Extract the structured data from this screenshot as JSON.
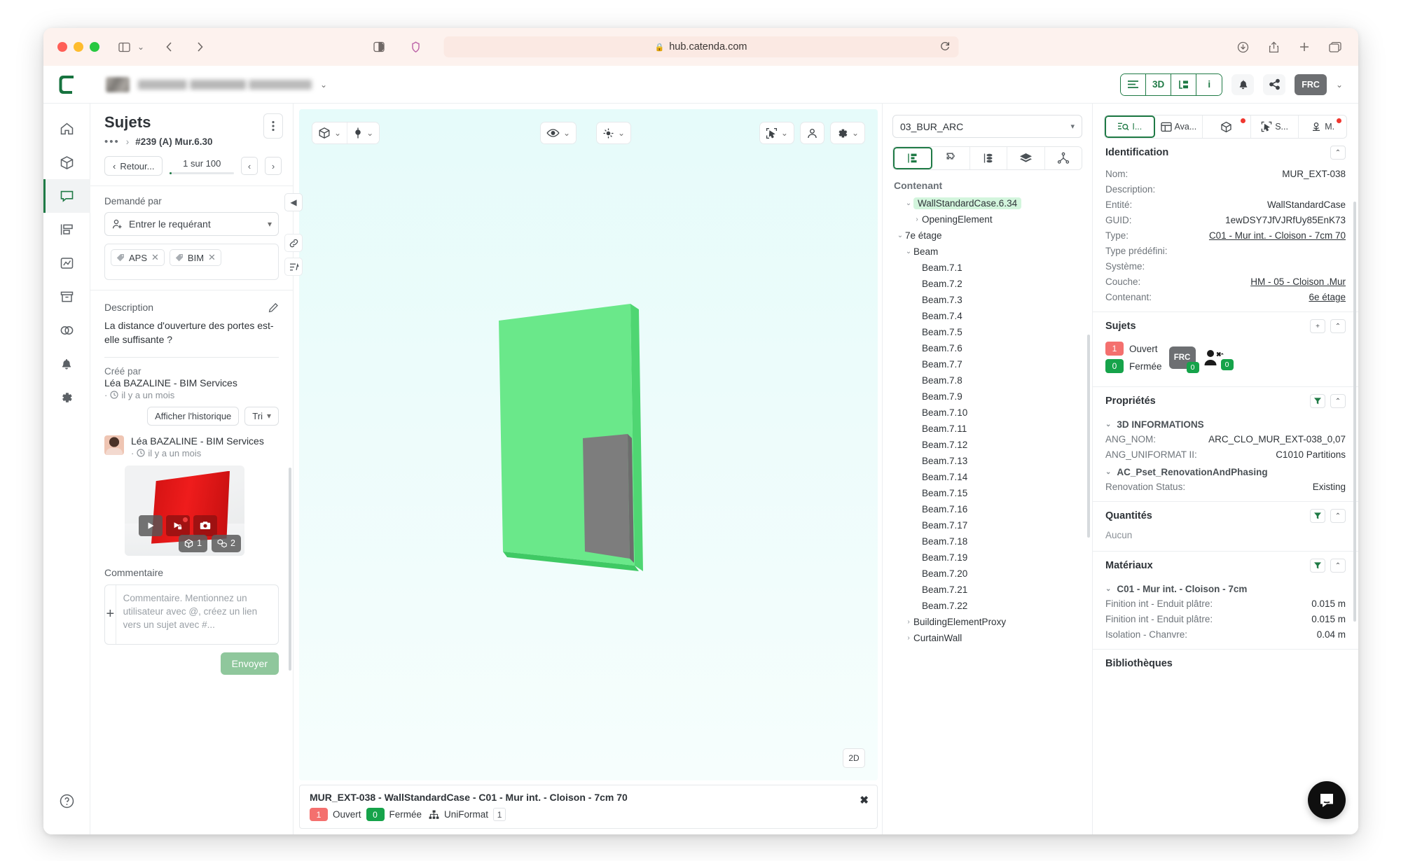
{
  "browser": {
    "url": "hub.catenda.com",
    "lock_icon": "lock-icon",
    "reload_icon": "reload-icon"
  },
  "app_header": {
    "logo": "catenda-logo",
    "view_toggle": [
      {
        "label": "≡",
        "name": "list-view"
      },
      {
        "label": "3D",
        "name": "3d-view"
      },
      {
        "label": "⇥",
        "name": "tree-view"
      },
      {
        "label": "i",
        "name": "info-view"
      }
    ],
    "notifications_icon": "bell-icon",
    "share_icon": "share-icon",
    "avatar_initials": "FRC"
  },
  "rail": {
    "items": [
      {
        "name": "home",
        "icon": "home-icon"
      },
      {
        "name": "models",
        "icon": "cube-icon"
      },
      {
        "name": "issues",
        "icon": "chat-icon",
        "active": true
      },
      {
        "name": "documents",
        "icon": "kanban-icon"
      },
      {
        "name": "reports",
        "icon": "chart-icon"
      },
      {
        "name": "archive",
        "icon": "archive-icon"
      },
      {
        "name": "compare",
        "icon": "layers-icon"
      },
      {
        "name": "notifications",
        "icon": "bell-icon"
      },
      {
        "name": "settings",
        "icon": "gear-icon"
      }
    ],
    "help_icon": "question-icon"
  },
  "sujets": {
    "title": "Sujets",
    "breadcrumb_dots": "•••",
    "breadcrumb_sep": "›",
    "breadcrumb_current": "#239 (A) Mur.6.30",
    "kebab_icon": "kebab-menu-icon",
    "back_label": "Retour...",
    "counter": "1 sur 100",
    "prev_icon": "‹",
    "next_icon": "›",
    "requested_by_label": "Demandé par",
    "requester_placeholder": "Entrer le requérant",
    "tags": [
      {
        "label": "APS"
      },
      {
        "label": "BIM"
      }
    ],
    "description_label": "Description",
    "description_edit_icon": "pencil-icon",
    "description_text": "La distance d'ouverture des portes est-elle suffisante ?",
    "created_by_label": "Créé par",
    "created_by_name": "Léa BAZALINE - BIM Services",
    "created_time": "il y a un mois",
    "history_button": "Afficher l'historique",
    "sort_button": "Tri",
    "comment_author": "Léa BAZALINE - BIM Services",
    "comment_time": "il y a un mois",
    "thumb_badges": [
      {
        "icon": "cube-icon",
        "value": "1"
      },
      {
        "icon": "cubes-icon",
        "value": "2"
      }
    ],
    "thumb_controls": [
      {
        "name": "play-icon"
      },
      {
        "name": "play-lock-icon"
      },
      {
        "name": "camera-icon"
      }
    ],
    "comment_label": "Commentaire",
    "comment_placeholder": "Commentaire. Mentionnez un utilisateur avec @, créez un lien vers un sujet avec #...",
    "add_icon": "plus-icon",
    "send_label": "Envoyer"
  },
  "viewer": {
    "toolbar_left": [
      {
        "name": "cube-icon",
        "caret": "⌄"
      },
      {
        "name": "pin-icon",
        "caret": "⌄"
      }
    ],
    "toolbar_mid": [
      {
        "name": "eye-icon",
        "caret": "⌄"
      },
      {
        "name": "explode-icon",
        "caret": "⌄"
      }
    ],
    "toolbar_right": [
      {
        "name": "select-icon",
        "caret": "⌄"
      },
      {
        "name": "person-icon",
        "caret": ""
      },
      {
        "name": "gear-icon",
        "caret": "⌄"
      }
    ],
    "btn_2d": "2D",
    "status": {
      "title": "MUR_EXT-038 - WallStandardCase - C01 - Mur int. - Cloison - 7cm 70",
      "open_count": "1",
      "open_label": "Ouvert",
      "closed_count": "0",
      "closed_label": "Fermée",
      "uniformat_icon": "hierarchy-icon",
      "uniformat_label": "UniFormat",
      "uniformat_count": "1",
      "close_icon": "✖"
    }
  },
  "tree": {
    "model": "03_BUR_ARC",
    "tabs": [
      {
        "name": "structure-icon",
        "active": true
      },
      {
        "name": "puzzle-icon",
        "active": false
      },
      {
        "name": "stack-icon",
        "active": false
      },
      {
        "name": "layers-icon",
        "active": false
      },
      {
        "name": "topology-icon",
        "active": false
      }
    ],
    "heading": "Contenant",
    "nodes": [
      {
        "label": "WallStandardCase.6.34",
        "indent": 2,
        "arrow": "⌄",
        "highlight": true
      },
      {
        "label": "OpeningElement",
        "indent": 3,
        "arrow": "›"
      },
      {
        "label": "7e étage",
        "indent": 1,
        "arrow": "⌄"
      },
      {
        "label": "Beam",
        "indent": 2,
        "arrow": "⌄"
      },
      {
        "label": "Beam.7.1",
        "indent": 3
      },
      {
        "label": "Beam.7.2",
        "indent": 3
      },
      {
        "label": "Beam.7.3",
        "indent": 3
      },
      {
        "label": "Beam.7.4",
        "indent": 3
      },
      {
        "label": "Beam.7.5",
        "indent": 3
      },
      {
        "label": "Beam.7.6",
        "indent": 3
      },
      {
        "label": "Beam.7.7",
        "indent": 3
      },
      {
        "label": "Beam.7.8",
        "indent": 3
      },
      {
        "label": "Beam.7.9",
        "indent": 3
      },
      {
        "label": "Beam.7.10",
        "indent": 3
      },
      {
        "label": "Beam.7.11",
        "indent": 3
      },
      {
        "label": "Beam.7.12",
        "indent": 3
      },
      {
        "label": "Beam.7.13",
        "indent": 3
      },
      {
        "label": "Beam.7.14",
        "indent": 3
      },
      {
        "label": "Beam.7.15",
        "indent": 3
      },
      {
        "label": "Beam.7.16",
        "indent": 3
      },
      {
        "label": "Beam.7.17",
        "indent": 3
      },
      {
        "label": "Beam.7.18",
        "indent": 3
      },
      {
        "label": "Beam.7.19",
        "indent": 3
      },
      {
        "label": "Beam.7.20",
        "indent": 3
      },
      {
        "label": "Beam.7.21",
        "indent": 3
      },
      {
        "label": "Beam.7.22",
        "indent": 3
      },
      {
        "label": "BuildingElementProxy",
        "indent": 2,
        "arrow": "›"
      },
      {
        "label": "CurtainWall",
        "indent": 2,
        "arrow": "›"
      }
    ]
  },
  "properties": {
    "tabs": [
      {
        "label": "I...",
        "icon": "identification-icon",
        "active": true,
        "dot": false
      },
      {
        "label": "Ava...",
        "icon": "table-icon",
        "active": false,
        "dot": false
      },
      {
        "label": "",
        "icon": "cube-icon",
        "active": false,
        "dot": true
      },
      {
        "label": "S...",
        "icon": "select-icon",
        "active": false,
        "dot": false
      },
      {
        "label": "M.",
        "icon": "anchor-icon",
        "active": false,
        "dot": true
      }
    ],
    "identification": {
      "title": "Identification",
      "rows": [
        {
          "key": "Nom:",
          "value": "MUR_EXT-038",
          "link": false
        },
        {
          "key": "Description:",
          "value": "",
          "link": false
        },
        {
          "key": "Entité:",
          "value": "WallStandardCase",
          "link": false
        },
        {
          "key": "GUID:",
          "value": "1ewDSY7JfVJRfUy85EnK73",
          "link": false
        },
        {
          "key": "Type:",
          "value": "C01 - Mur int. - Cloison - 7cm 70",
          "link": true
        },
        {
          "key": "Type prédéfini:",
          "value": "",
          "link": false
        },
        {
          "key": "Système:",
          "value": "",
          "link": false
        },
        {
          "key": "Couche:",
          "value": "HM - 05 - Cloison .Mur",
          "link": true
        },
        {
          "key": "Contenant:",
          "value": "6e étage",
          "link": true
        }
      ]
    },
    "sujets": {
      "title": "Sujets",
      "add_icon": "plus-icon",
      "open_count": "1",
      "open_label": "Ouvert",
      "closed_count": "0",
      "closed_label": "Fermée",
      "avatar_initials": "FRC",
      "avatar_badge": "0",
      "unassigned_badge": "0"
    },
    "proprietes": {
      "title": "Propriétés",
      "groups": [
        {
          "name": "3D INFORMATIONS",
          "rows": [
            {
              "key": "ANG_NOM:",
              "value": "ARC_CLO_MUR_EXT-038_0,07"
            },
            {
              "key": "ANG_UNIFORMAT II:",
              "value": "C1010 Partitions"
            }
          ]
        },
        {
          "name": "AC_Pset_RenovationAndPhasing",
          "rows": [
            {
              "key": "Renovation Status:",
              "value": "Existing"
            }
          ]
        }
      ]
    },
    "quantites": {
      "title": "Quantités",
      "empty": "Aucun"
    },
    "materiaux": {
      "title": "Matériaux",
      "group": "C01 - Mur int. - Cloison - 7cm",
      "rows": [
        {
          "key": "Finition int - Enduit plâtre:",
          "value": "0.015 m"
        },
        {
          "key": "Finition int - Enduit plâtre:",
          "value": "0.015 m"
        },
        {
          "key": "Isolation - Chanvre:",
          "value": "0.04 m"
        }
      ]
    },
    "bibliotheques": {
      "title": "Bibliothèques"
    },
    "filter_icon": "filter-icon",
    "collapse_icon": "chevron-up-icon"
  },
  "chat": {
    "icon": "intercom-chat-icon"
  }
}
